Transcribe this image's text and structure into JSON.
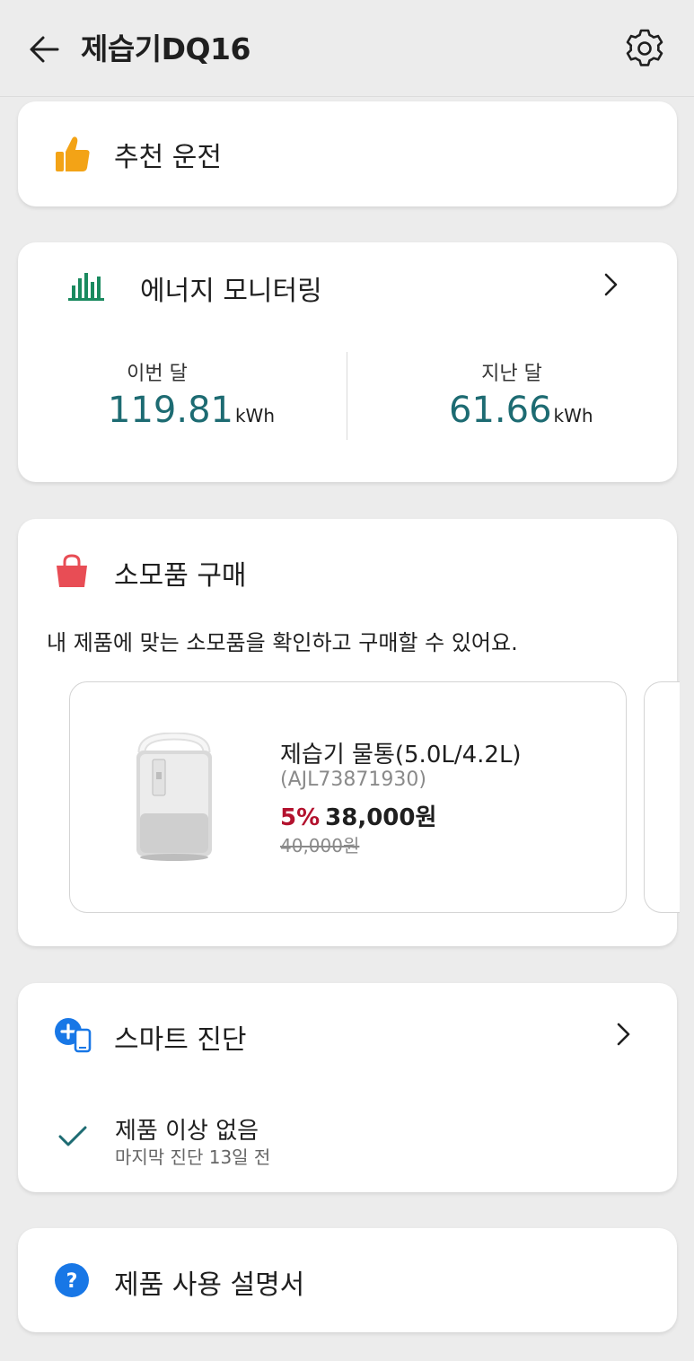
{
  "header": {
    "title": "제습기DQ16"
  },
  "recommend": {
    "title": "추천 운전"
  },
  "energy": {
    "title": "에너지 모니터링",
    "this_month": {
      "label": "이번 달",
      "value": "119.81",
      "unit": "kWh"
    },
    "last_month": {
      "label": "지난 달",
      "value": "61.66",
      "unit": "kWh"
    }
  },
  "consumables": {
    "title": "소모품 구매",
    "description": "내 제품에 맞는 소모품을 확인하고 구매할 수 있어요.",
    "products": [
      {
        "name": "제습기 물통(5.0L/4.2L)",
        "code": "(AJL73871930)",
        "discount": "5%",
        "price": "38,000원",
        "original_price": "40,000원"
      }
    ]
  },
  "diagnosis": {
    "title": "스마트 진단",
    "status": "제품 이상 없음",
    "last_check": "마지막 진단 13일 전"
  },
  "manual": {
    "title": "제품 사용 설명서"
  },
  "colors": {
    "accent_teal": "#1d6b72",
    "discount_red": "#b3122e",
    "bag_red": "#e84d55",
    "thumb_orange": "#f3a316",
    "info_blue": "#1877e6"
  }
}
